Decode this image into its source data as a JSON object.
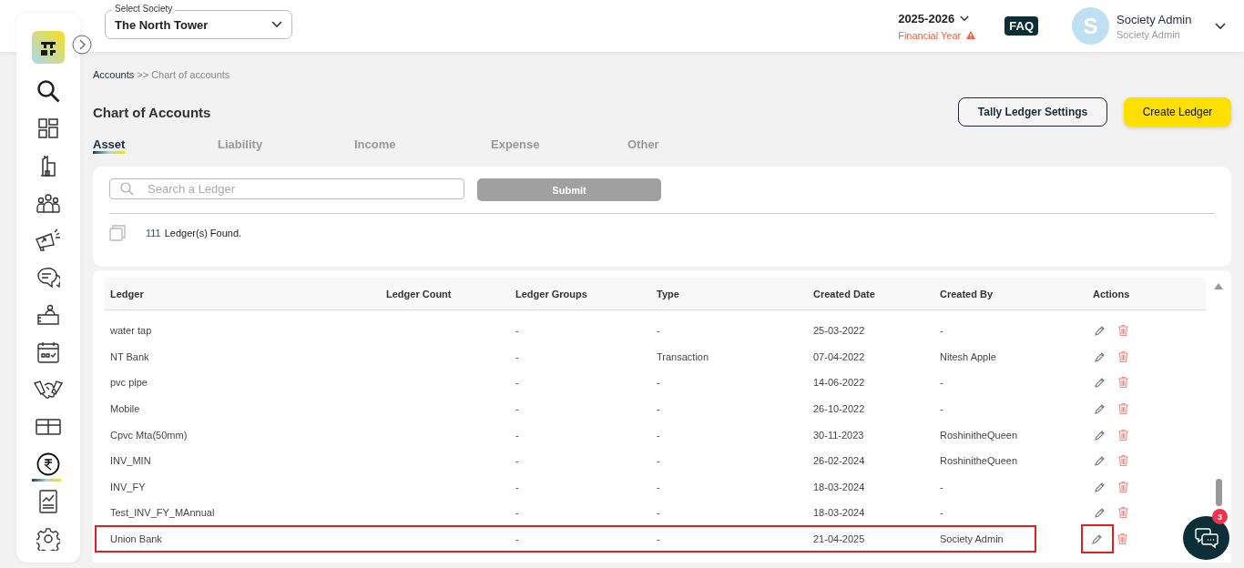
{
  "header": {
    "society_select": {
      "label": "Select Society",
      "value": "The North Tower"
    },
    "year": {
      "value": "2025-2026",
      "caption": "Financial Year"
    },
    "faq": "FAQ",
    "user": {
      "initial": "S",
      "name": "Society Admin",
      "role": "Society Admin"
    }
  },
  "sidebar": {
    "items": [
      {
        "kind": "search",
        "selected": false
      },
      {
        "kind": "dashboard",
        "selected": false
      },
      {
        "kind": "building",
        "selected": false
      },
      {
        "kind": "people",
        "selected": false
      },
      {
        "kind": "megaphone",
        "selected": false
      },
      {
        "kind": "chat",
        "selected": false
      },
      {
        "kind": "desk",
        "selected": false
      },
      {
        "kind": "calendar",
        "selected": false
      },
      {
        "kind": "handshake",
        "selected": false
      },
      {
        "kind": "box",
        "selected": false
      },
      {
        "kind": "rupee",
        "selected": true
      },
      {
        "kind": "report",
        "selected": false
      },
      {
        "kind": "settings",
        "selected": false
      }
    ]
  },
  "breadcrumb": [
    "Accounts",
    ">> Chart of accounts"
  ],
  "title": "Chart of Accounts",
  "buttons": {
    "settings": "Tally Ledger Settings",
    "create": "Create Ledger"
  },
  "tabs": [
    {
      "label": "Asset",
      "selected": true
    },
    {
      "label": "Liability",
      "selected": false
    },
    {
      "label": "Income",
      "selected": false
    },
    {
      "label": "Expense",
      "selected": false
    },
    {
      "label": "Other",
      "selected": false
    }
  ],
  "search": {
    "placeholder": "Search a Ledger",
    "submit": "Submit"
  },
  "found": {
    "count": "111",
    "text": "Ledger(s) Found."
  },
  "table": {
    "columns": [
      "Ledger",
      "Ledger Count",
      "Ledger Groups",
      "Type",
      "Created Date",
      "Created By",
      "Actions"
    ],
    "rows": [
      {
        "ledger": "water tap",
        "groups": "-",
        "type": "-",
        "date": "25-03-2022",
        "by": "-",
        "highlighted": false
      },
      {
        "ledger": "NT Bank",
        "groups": "-",
        "type": "Transaction",
        "date": "07-04-2022",
        "by": "Nitesh Apple",
        "highlighted": false
      },
      {
        "ledger": "pvc pipe",
        "groups": "-",
        "type": "-",
        "date": "14-06-2022",
        "by": "-",
        "highlighted": false
      },
      {
        "ledger": "Mobile",
        "groups": "-",
        "type": "-",
        "date": "26-10-2022",
        "by": "-",
        "highlighted": false
      },
      {
        "ledger": "Cpvc Mta(50mm)",
        "groups": "-",
        "type": "-",
        "date": "30-11-2023",
        "by": "RoshinitheQueen",
        "highlighted": false
      },
      {
        "ledger": "INV_MIN",
        "groups": "-",
        "type": "-",
        "date": "26-02-2024",
        "by": "RoshinitheQueen",
        "highlighted": false
      },
      {
        "ledger": "INV_FY",
        "groups": "-",
        "type": "-",
        "date": "18-03-2024",
        "by": "-",
        "highlighted": false
      },
      {
        "ledger": "Test_INV_FY_MAnnual",
        "groups": "-",
        "type": "-",
        "date": "18-03-2024",
        "by": "-",
        "highlighted": false
      },
      {
        "ledger": "Union Bank",
        "groups": "-",
        "type": "-",
        "date": "21-04-2025",
        "by": "Society Admin",
        "highlighted": true
      }
    ]
  },
  "chat": {
    "badge": "3"
  }
}
